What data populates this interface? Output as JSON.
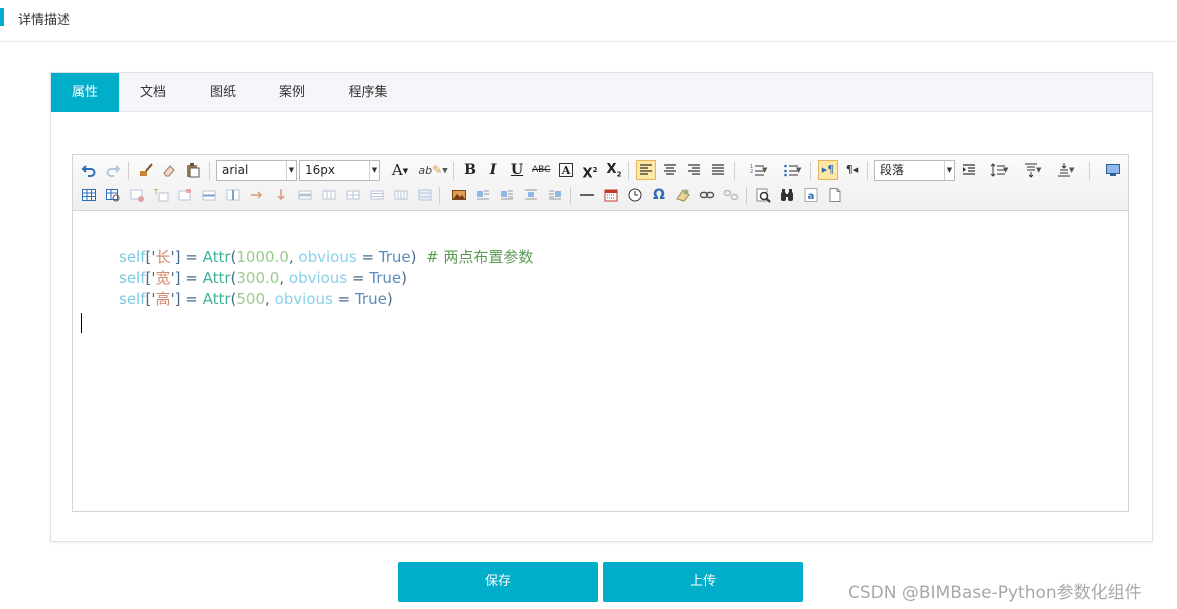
{
  "header": {
    "title": "详情描述"
  },
  "tabs": [
    {
      "label": "属性",
      "active": true
    },
    {
      "label": "文档",
      "active": false
    },
    {
      "label": "图纸",
      "active": false
    },
    {
      "label": "案例",
      "active": false
    },
    {
      "label": "程序集",
      "active": false
    }
  ],
  "toolbar": {
    "font_family": "arial",
    "font_size": "16px",
    "paragraph_format": "段落"
  },
  "editor_lines": [
    {
      "self": "self",
      "open": "['",
      "key": "长",
      "close": "']",
      "eq": " = ",
      "fn": "Attr",
      "paren_open": "(",
      "num": "1000.0",
      "comma": ", ",
      "kw": "obvious",
      "eq2": " = ",
      "val": "True",
      "paren_close": ")",
      "comment": "  # 两点布置参数"
    },
    {
      "self": "self",
      "open": "['",
      "key": "宽",
      "close": "']",
      "eq": " = ",
      "fn": "Attr",
      "paren_open": "(",
      "num": "300.0",
      "comma": ", ",
      "kw": "obvious",
      "eq2": " = ",
      "val": "True",
      "paren_close": ")",
      "comment": ""
    },
    {
      "self": "self",
      "open": "['",
      "key": "高",
      "close": "']",
      "eq": " = ",
      "fn": "Attr",
      "paren_open": "(",
      "num": "500",
      "comma": ", ",
      "kw": "obvious",
      "eq2": " = ",
      "val": "True",
      "paren_close": ")",
      "comment": ""
    }
  ],
  "buttons": {
    "save": "保存",
    "upload": "上传"
  },
  "watermark": "CSDN @BIMBase-Python参数化组件",
  "colors": {
    "accent": "#00aec9"
  }
}
